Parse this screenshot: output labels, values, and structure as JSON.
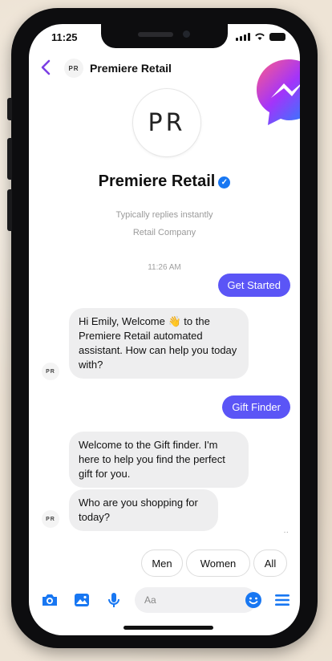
{
  "status": {
    "time": "11:25"
  },
  "header": {
    "avatar_initials": "PR",
    "title": "Premiere Retail"
  },
  "profile": {
    "initials": "PR",
    "name": "Premiere Retail",
    "reply_time": "Typically replies instantly",
    "category": "Retail Company"
  },
  "chat": {
    "timestamp": "11:26 AM",
    "bot_initials": "PR",
    "messages": [
      {
        "from": "user",
        "text": "Get Started"
      },
      {
        "from": "bot",
        "text": "Hi Emily, Welcome 👋 to the Premiere Retail automated assistant. How can help you today with?"
      },
      {
        "from": "user",
        "text": "Gift Finder"
      },
      {
        "from": "bot",
        "text": "Welcome to the Gift finder. I'm here to help you find the perfect gift for you."
      },
      {
        "from": "bot",
        "text": "Who are you shopping for today?"
      }
    ]
  },
  "quick_replies": [
    "Men",
    "Women",
    "All"
  ],
  "composer": {
    "placeholder": "Aa"
  },
  "colors": {
    "accent": "#5b55f6",
    "icon_blue": "#1877f2",
    "back_arrow": "#7b3fe4",
    "bubble_in": "#eeeeef"
  },
  "icons": [
    "back-icon",
    "verified-icon",
    "messenger-logo",
    "camera-icon",
    "gallery-icon",
    "microphone-icon",
    "emoji-icon",
    "menu-icon"
  ]
}
